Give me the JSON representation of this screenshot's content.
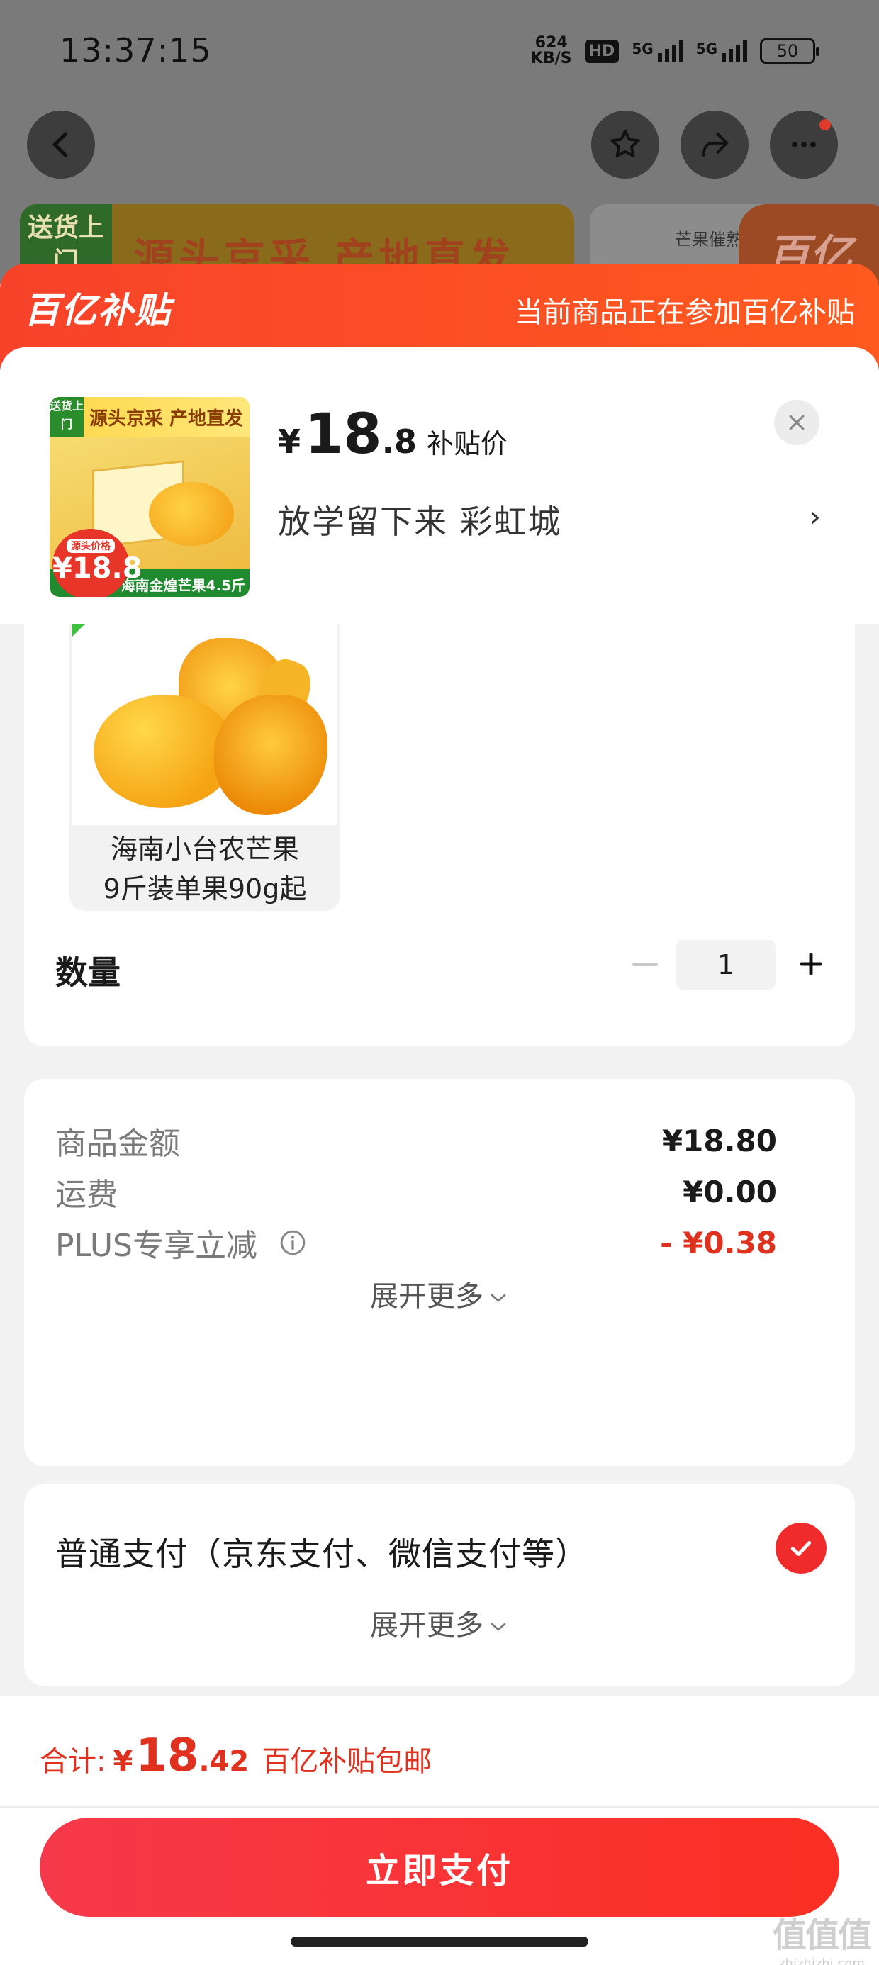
{
  "status_bar": {
    "time": "13:37:15",
    "net_speed_value": "624",
    "net_speed_unit": "KB/S",
    "hd_badge": "HD",
    "signal1": "5G",
    "signal2": "5G",
    "battery": "50"
  },
  "background": {
    "banner_left_tag": "送货上门",
    "banner_left_text": "源头京采 产地直发",
    "banner_right_small": "芒果催熟",
    "banner_right_logo": "百亿"
  },
  "sheet": {
    "logo": "百亿补贴",
    "note": "当前商品正在参加百亿补贴"
  },
  "product": {
    "price_currency": "¥",
    "price_int": "18",
    "price_dec": ".8",
    "price_label": "补贴价",
    "name": "放学留下来  彩虹城",
    "arrow": "›",
    "thumb": {
      "tag": "送货上门",
      "title": "源头京采 产地直发",
      "price_label": "源头价格",
      "price": "¥18.8",
      "bottom": "海南金煌芒果4.5斤"
    }
  },
  "variant": {
    "name_line1": "海南小台农芒果",
    "name_line2": "9斤装单果90g起"
  },
  "quantity": {
    "label": "数量",
    "value": "1"
  },
  "fees": {
    "goods_label": "商品金额",
    "goods_value": "¥18.80",
    "shipping_label": "运费",
    "shipping_value": "¥0.00",
    "plus_label": "PLUS专享立减",
    "plus_value": "- ¥0.38",
    "expand": "展开更多"
  },
  "payment": {
    "method": "普通支付（京东支付、微信支付等）",
    "expand": "展开更多"
  },
  "footer": {
    "total_label": "合计:",
    "total_currency": "¥",
    "total_int": "18",
    "total_dec": ".42",
    "total_note": "百亿补贴包邮",
    "pay_button": "立即支付"
  },
  "watermark": {
    "big": "值值值",
    "small": "zhizhizhi.com"
  },
  "colors": {
    "accent_red": "#f02b2b",
    "header_orange": "#ff5a1f",
    "price_red": "#e0301e"
  }
}
